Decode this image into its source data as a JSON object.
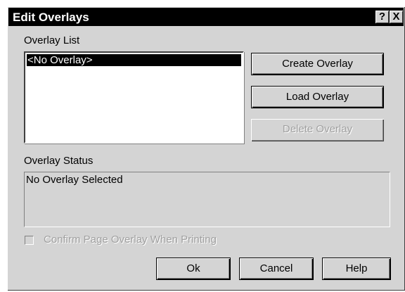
{
  "dialog": {
    "title": "Edit Overlays",
    "help_glyph": "?",
    "close_glyph": "X"
  },
  "overlay_list": {
    "label": "Overlay List",
    "items": [
      "<No Overlay>"
    ],
    "selected_index": 0
  },
  "buttons": {
    "create": "Create Overlay",
    "load": "Load Overlay",
    "delete": "Delete Overlay",
    "ok": "Ok",
    "cancel": "Cancel",
    "help": "Help"
  },
  "overlay_status": {
    "label": "Overlay Status",
    "text": "No Overlay Selected"
  },
  "confirm": {
    "label": "Confirm Page Overlay When Printing",
    "checked": false,
    "enabled": false
  }
}
